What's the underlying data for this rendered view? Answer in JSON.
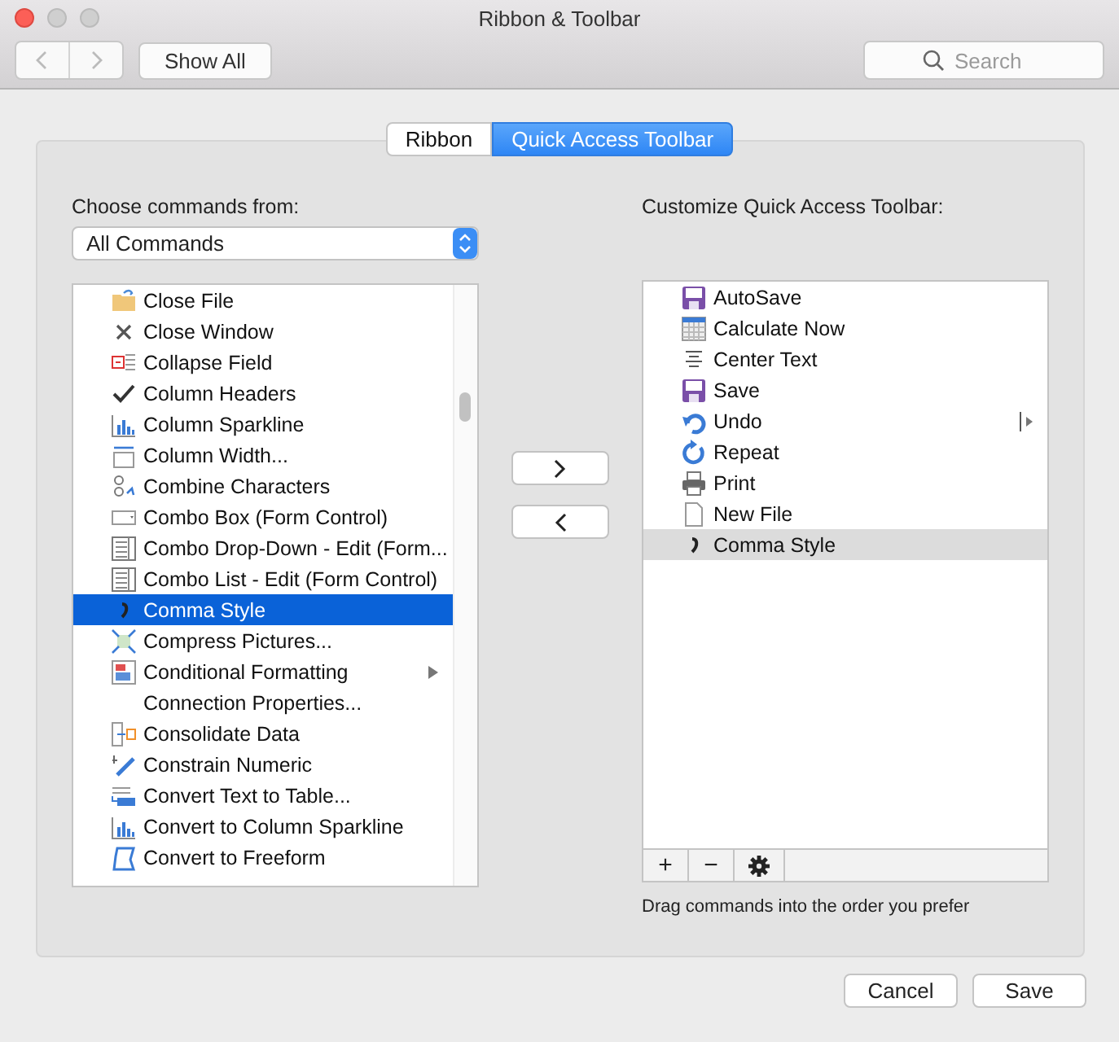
{
  "window": {
    "title": "Ribbon & Toolbar"
  },
  "toolbar": {
    "show_all": "Show All",
    "search": {
      "placeholder": "Search"
    }
  },
  "tabs": [
    {
      "label": "Ribbon",
      "selected": false
    },
    {
      "label": "Quick Access Toolbar",
      "selected": true
    }
  ],
  "source": {
    "label": "Choose commands from:",
    "value": "All Commands"
  },
  "commands": [
    {
      "label": "Close File",
      "selected": false,
      "submenu": false
    },
    {
      "label": "Close Window",
      "selected": false,
      "submenu": false
    },
    {
      "label": "Collapse Field",
      "selected": false,
      "submenu": false
    },
    {
      "label": "Column Headers",
      "selected": false,
      "submenu": false
    },
    {
      "label": "Column Sparkline",
      "selected": false,
      "submenu": false
    },
    {
      "label": "Column Width...",
      "selected": false,
      "submenu": false
    },
    {
      "label": "Combine Characters",
      "selected": false,
      "submenu": false
    },
    {
      "label": "Combo Box (Form Control)",
      "selected": false,
      "submenu": false
    },
    {
      "label": "Combo Drop-Down - Edit (Form...",
      "selected": false,
      "submenu": false
    },
    {
      "label": "Combo List - Edit (Form Control)",
      "selected": false,
      "submenu": false
    },
    {
      "label": "Comma Style",
      "selected": true,
      "submenu": false
    },
    {
      "label": "Compress Pictures...",
      "selected": false,
      "submenu": false
    },
    {
      "label": "Conditional Formatting",
      "selected": false,
      "submenu": true
    },
    {
      "label": "Connection Properties...",
      "selected": false,
      "submenu": false
    },
    {
      "label": "Consolidate Data",
      "selected": false,
      "submenu": false
    },
    {
      "label": "Constrain Numeric",
      "selected": false,
      "submenu": false
    },
    {
      "label": "Convert Text to Table...",
      "selected": false,
      "submenu": false
    },
    {
      "label": "Convert to Column Sparkline",
      "selected": false,
      "submenu": false
    },
    {
      "label": "Convert to Freeform",
      "selected": false,
      "submenu": false
    }
  ],
  "move_buttons": [
    {
      "kind": "add"
    },
    {
      "kind": "remove"
    }
  ],
  "customize": {
    "label": "Customize Quick Access Toolbar:",
    "items": [
      {
        "label": "AutoSave",
        "selected": false,
        "submenu": false
      },
      {
        "label": "Calculate Now",
        "selected": false,
        "submenu": false
      },
      {
        "label": "Center Text",
        "selected": false,
        "submenu": false
      },
      {
        "label": "Save",
        "selected": false,
        "submenu": false
      },
      {
        "label": "Undo",
        "selected": false,
        "submenu": true
      },
      {
        "label": "Repeat",
        "selected": false,
        "submenu": false
      },
      {
        "label": "Print",
        "selected": false,
        "submenu": false
      },
      {
        "label": "New File",
        "selected": false,
        "submenu": false
      },
      {
        "label": "Comma Style",
        "selected": true,
        "submenu": false
      }
    ],
    "footer_buttons": [
      "+",
      "−"
    ],
    "hint": "Drag commands into the order you prefer"
  },
  "buttons": [
    "Cancel",
    "Save"
  ]
}
